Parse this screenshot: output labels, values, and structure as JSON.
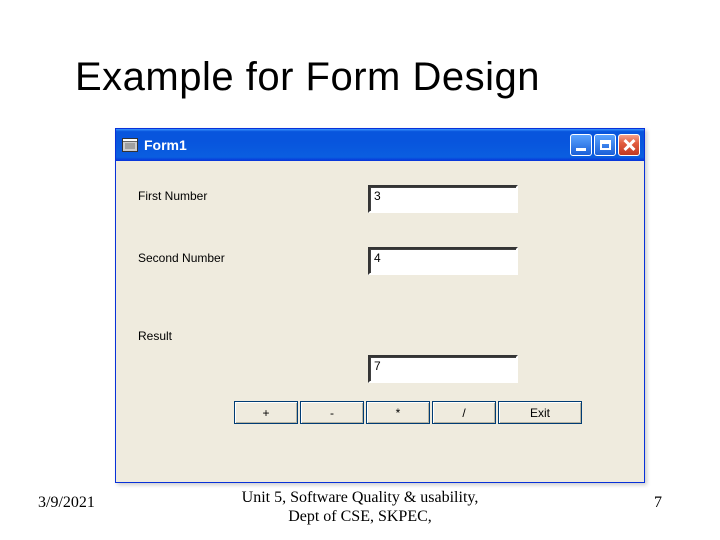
{
  "slide": {
    "title": "Example for  Form Design"
  },
  "window": {
    "title": "Form1"
  },
  "fields": {
    "first": {
      "label": "First Number",
      "value": "3"
    },
    "second": {
      "label": "Second Number",
      "value": "4"
    },
    "result": {
      "label": "Result",
      "value": "7"
    }
  },
  "buttons": {
    "add": "+",
    "subtract": "-",
    "multiply": "*",
    "divide": "/",
    "exit": "Exit"
  },
  "footer": {
    "date": "3/9/2021",
    "center_line1": "Unit 5, Software Quality & usability,",
    "center_line2": "Dept of CSE, SKPEC,",
    "page": "7"
  }
}
